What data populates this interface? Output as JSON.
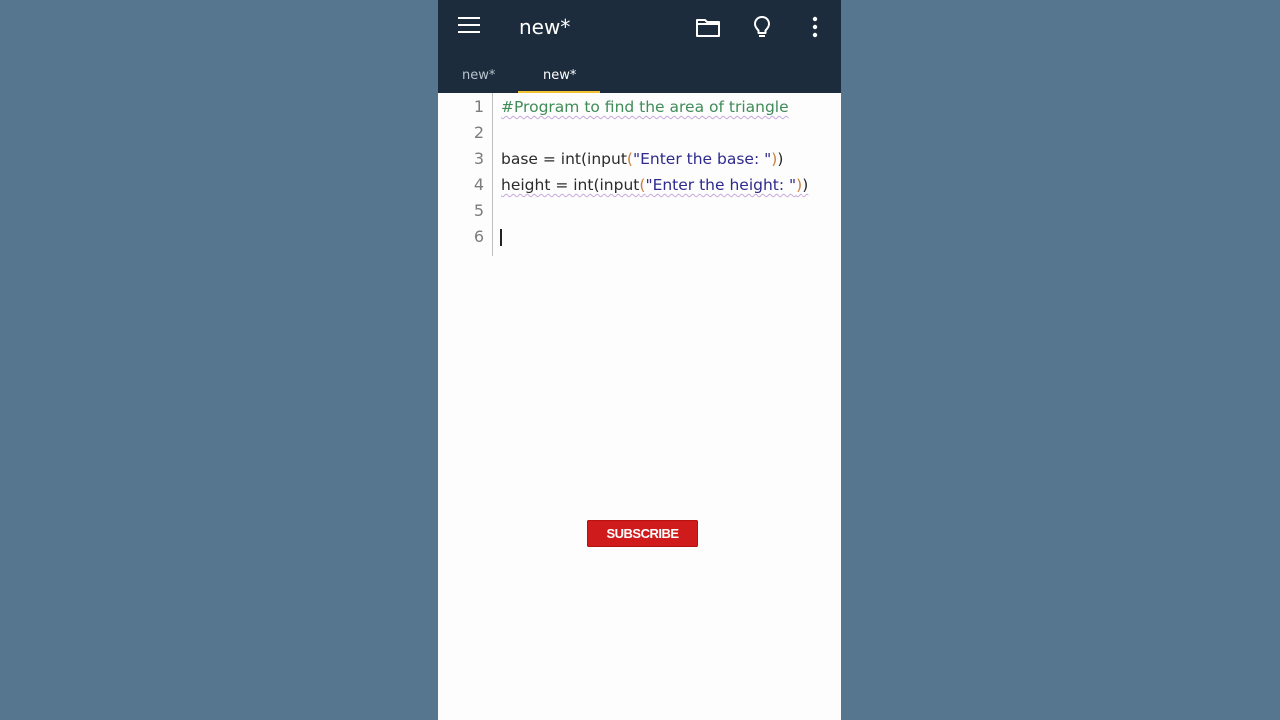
{
  "appbar": {
    "title": "new*",
    "icons": [
      "menu-icon",
      "folder-icon",
      "lightbulb-icon",
      "more-vert-icon"
    ]
  },
  "tabs": [
    {
      "label": "new*",
      "active": false
    },
    {
      "label": "new*",
      "active": true
    }
  ],
  "editor": {
    "line_numbers": [
      "1",
      "2",
      "3",
      "4",
      "5",
      "6"
    ],
    "lines": {
      "l1_comment": "#Program to find the area of triangle",
      "l3_pre": "base = int(input",
      "l3_open": "(",
      "l3_str": "\"Enter the base: \"",
      "l3_close": ")",
      "l3_tail": ")",
      "l4_pre": "height = int(input",
      "l4_open": "(",
      "l4_str": "\"Enter the height: \"",
      "l4_close": ")",
      "l4_tail": ")"
    },
    "cursor_line": 6
  },
  "overlay": {
    "subscribe_label": "SUBSCRIBE"
  },
  "colors": {
    "background": "#56758f",
    "appbar": "#1c2c3c",
    "tab_indicator": "#f2c230",
    "comment": "#3f8c58",
    "string": "#2e2a8e",
    "subscribe": "#cf1b1b"
  }
}
